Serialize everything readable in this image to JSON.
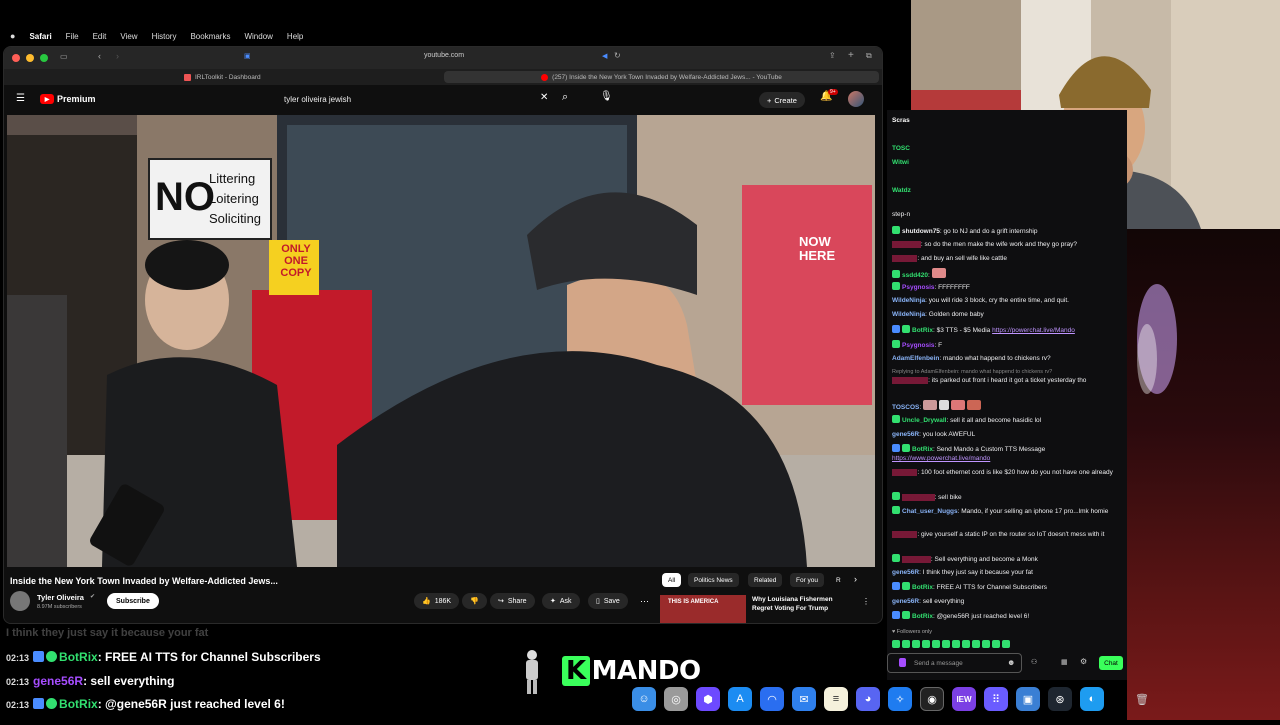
{
  "menubar": {
    "apple": "",
    "app": "Safari",
    "items": [
      "File",
      "Edit",
      "View",
      "History",
      "Bookmarks",
      "Window",
      "Help"
    ]
  },
  "safari": {
    "url": "youtube.com",
    "tabs": [
      {
        "label": "IRLToolkit - Dashboard"
      },
      {
        "label": "(257) Inside the New York Town Invaded by Welfare-Addicted Jews... - YouTube"
      }
    ]
  },
  "youtube": {
    "logo": "Premium",
    "search_query": "tyler oliveira jewish",
    "create_label": "Create",
    "notification_count": "9+",
    "video": {
      "sign_text": [
        "NO",
        "Littering",
        "Loitering",
        "Soliciting"
      ],
      "one_copy": [
        "ONLY",
        "ONE",
        "COPY"
      ],
      "store_sign": [
        "NOW",
        "HERE"
      ],
      "title": "Inside the New York Town Invaded by Welfare-Addicted Jews...",
      "channel": "Tyler Oliveira",
      "subscribers": "8.97M subscribers",
      "subscribe_label": "Subscribe",
      "likes": "186K",
      "share_label": "Share",
      "ask_label": "Ask",
      "save_label": "Save"
    },
    "chips": [
      "All",
      "Politics News",
      "Related",
      "For you",
      "R"
    ],
    "recommended": {
      "title": "Why Louisiana Fishermen Regret Voting For Trump",
      "thumb_text": "THIS IS AMERICA"
    }
  },
  "chat": {
    "messages": [
      {
        "user": "Scras",
        "text": "",
        "color": "#ffffff"
      },
      {
        "user": "TOSC",
        "text": "",
        "color": "#32e070"
      },
      {
        "user": "Witwi",
        "text": "",
        "color": "#32e070"
      },
      {
        "user": "",
        "text": "",
        "color": "#ffffff"
      },
      {
        "user": "Watdz",
        "text": "",
        "color": "#32e070"
      },
      {
        "user": "",
        "text": "step-n",
        "color": "#ffffff"
      },
      {
        "user": "shutdown75",
        "text": "go to NJ and do a grift internship",
        "color": "#ffffff"
      },
      {
        "user": "",
        "text": "so do the men make the wife work and they go pray?",
        "color": "#e0245e"
      },
      {
        "user": "",
        "text": "and buy an sell wife like cattle",
        "color": "#e0245e"
      },
      {
        "user": "ssdd420",
        "text": "",
        "color": "#32e070"
      },
      {
        "user": "Psygnosis",
        "text": "FFFFFFFF",
        "color": "#a64dff"
      },
      {
        "user": "WildeNinja",
        "text": "you will ride 3 block, cry the entire time, and quit.",
        "color": "#8ab4f8"
      },
      {
        "user": "WildeNinja",
        "text": "Golden dome baby",
        "color": "#8ab4f8"
      },
      {
        "user": "BotRix",
        "text": "$3 TTS - $5 Media ",
        "link": "https://powerchat.live/Mando",
        "color": "#32e070"
      },
      {
        "user": "Psygnosis",
        "text": "F",
        "color": "#a64dff"
      },
      {
        "user": "AdamElfenbein",
        "text": "mando what happend to chickens rv?",
        "color": "#8ab4f8"
      },
      {
        "user": "",
        "text": "Replying to AdamElfenbein: mando what happend to chickens rv?",
        "color": "#888888"
      },
      {
        "user": "",
        "text": "its parked out front i heard it got a ticket yesterday tho",
        "color": "#e0245e"
      },
      {
        "user": "TOSCOS",
        "text": "",
        "color": "#8ab4f8"
      },
      {
        "user": "Uncle_Drywall",
        "text": "sell it all and become hasidic lol",
        "color": "#32e070"
      },
      {
        "user": "gene56R",
        "text": "you look AWEFUL",
        "color": "#8ab4f8"
      },
      {
        "user": "BotRix",
        "text": "Send Mando a Custom TTS Message ",
        "link": "https://www.powerchat.live/mando",
        "color": "#32e070"
      },
      {
        "user": "",
        "text": "100 foot ethernet cord is like $20 how do you not have one already",
        "color": "#e0245e"
      },
      {
        "user": "",
        "text": "sell bike",
        "color": "#e0245e"
      },
      {
        "user": "Chat_user_Nuggs",
        "text": "Mando, if your selling an iphone 17 pro...lmk homie",
        "color": "#8ab4f8"
      },
      {
        "user": "",
        "text": "give yourself a static IP on the router so IoT doesn't mess with it",
        "color": "#e0245e"
      },
      {
        "user": "",
        "text": "Sell everything and become a Monk",
        "color": "#e0245e"
      },
      {
        "user": "gene56R",
        "text": "I think they just say it because your fat",
        "color": "#8ab4f8"
      },
      {
        "user": "BotRix",
        "text": "FREE AI TTS for Channel Subscribers",
        "color": "#32e070"
      },
      {
        "user": "gene56R",
        "text": "sell everything",
        "color": "#8ab4f8"
      },
      {
        "user": "BotRix",
        "text": "@gene56R just reached level 6!",
        "color": "#32e070"
      }
    ],
    "followers_only": "Followers only",
    "input_placeholder": "Send a message",
    "chat_button": "Chat"
  },
  "overlay": {
    "faded": "I think they just say it because your fat",
    "lines": [
      {
        "time": "02:13",
        "user": "BotRix",
        "text": "FREE AI TTS for Channel Subscribers",
        "bot": true
      },
      {
        "time": "02:13",
        "user": "gene56R",
        "text": "sell everything",
        "bot": false
      },
      {
        "time": "02:13",
        "user": "BotRix",
        "text": "@gene56R just reached level 6!",
        "bot": true
      }
    ],
    "logo_k": "K",
    "logo_rest": "MANDO"
  },
  "dock": [
    "finder-icon",
    "launchpad-icon",
    "proton-icon",
    "app-store-icon",
    "arc-icon",
    "mail-icon",
    "notes-icon",
    "discord-icon",
    "safari-icon",
    "obs-icon",
    "news-icon",
    "grid-icon",
    "finder2-icon",
    "app-icon",
    "edge-icon",
    "trash-icon"
  ]
}
